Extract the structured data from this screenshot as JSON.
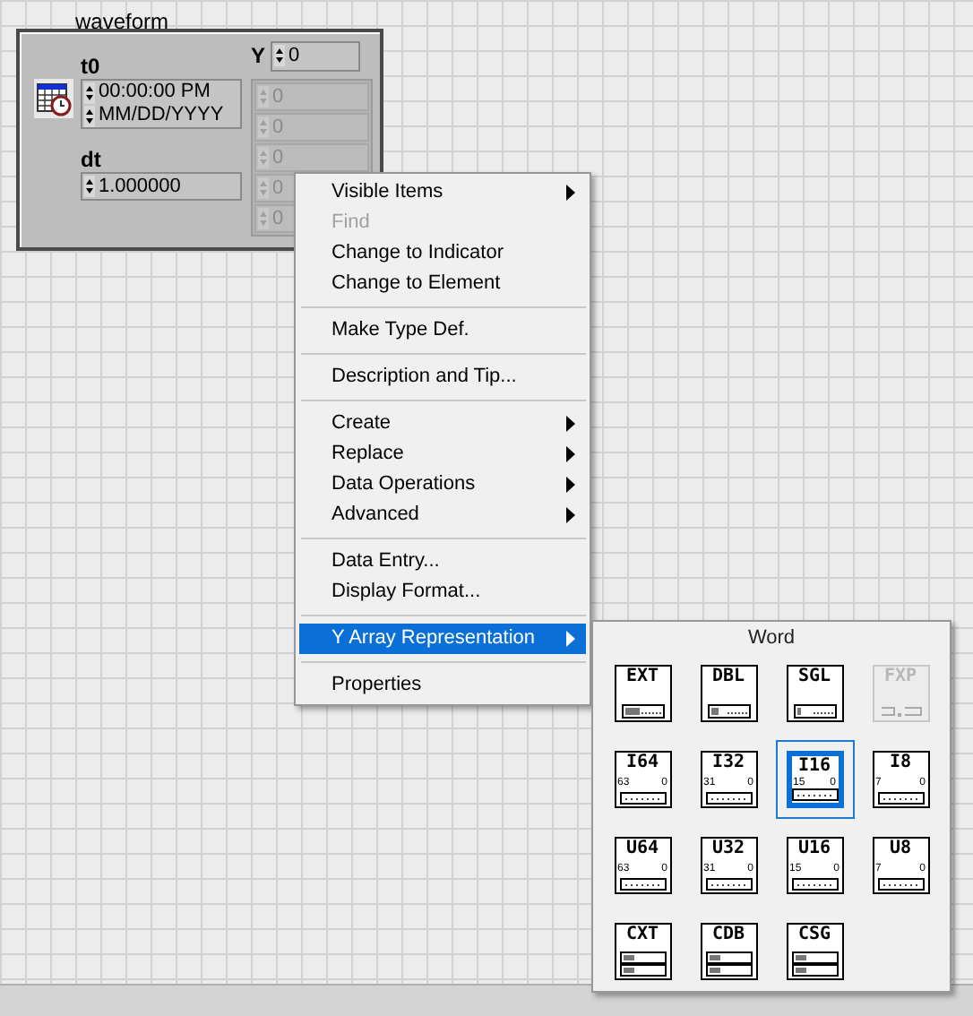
{
  "cluster": {
    "label": "waveform",
    "t0": {
      "label": "t0",
      "time": "00:00:00 PM",
      "date": "MM/DD/YYYY"
    },
    "dt": {
      "label": "dt",
      "value": "1.000000"
    },
    "y": {
      "label": "Y",
      "index": "0",
      "values": [
        {
          "value": "0",
          "disabled": true
        },
        {
          "value": "0",
          "disabled": true
        },
        {
          "value": "0",
          "disabled": true
        },
        {
          "value": "0",
          "disabled": true
        },
        {
          "value": "0",
          "disabled": true
        }
      ]
    }
  },
  "context_menu": [
    {
      "kind": "item",
      "label": "Visible Items",
      "submenu": true,
      "disabled": false,
      "selected": false
    },
    {
      "kind": "item",
      "label": "Find",
      "submenu": false,
      "disabled": true,
      "selected": false
    },
    {
      "kind": "item",
      "label": "Change to Indicator",
      "submenu": false,
      "disabled": false,
      "selected": false
    },
    {
      "kind": "item",
      "label": "Change to Element",
      "submenu": false,
      "disabled": false,
      "selected": false
    },
    {
      "kind": "separator"
    },
    {
      "kind": "item",
      "label": "Make Type Def.",
      "submenu": false,
      "disabled": false,
      "selected": false
    },
    {
      "kind": "separator"
    },
    {
      "kind": "item",
      "label": "Description and Tip...",
      "submenu": false,
      "disabled": false,
      "selected": false
    },
    {
      "kind": "separator"
    },
    {
      "kind": "item",
      "label": "Create",
      "submenu": true,
      "disabled": false,
      "selected": false
    },
    {
      "kind": "item",
      "label": "Replace",
      "submenu": true,
      "disabled": false,
      "selected": false
    },
    {
      "kind": "item",
      "label": "Data Operations",
      "submenu": true,
      "disabled": false,
      "selected": false
    },
    {
      "kind": "item",
      "label": "Advanced",
      "submenu": true,
      "disabled": false,
      "selected": false
    },
    {
      "kind": "separator"
    },
    {
      "kind": "item",
      "label": "Data Entry...",
      "submenu": false,
      "disabled": false,
      "selected": false
    },
    {
      "kind": "item",
      "label": "Display Format...",
      "submenu": false,
      "disabled": false,
      "selected": false
    },
    {
      "kind": "separator"
    },
    {
      "kind": "item",
      "label": "Y Array Representation",
      "submenu": true,
      "disabled": false,
      "selected": true
    },
    {
      "kind": "separator"
    },
    {
      "kind": "item",
      "label": "Properties",
      "submenu": false,
      "disabled": false,
      "selected": false
    }
  ],
  "representation_palette": {
    "title": "Word",
    "types": [
      {
        "label": "EXT",
        "kind": "float",
        "selected": false,
        "disabled": false
      },
      {
        "label": "DBL",
        "kind": "float",
        "selected": false,
        "disabled": false
      },
      {
        "label": "SGL",
        "kind": "float",
        "selected": false,
        "disabled": false
      },
      {
        "label": "FXP",
        "kind": "fixed",
        "selected": false,
        "disabled": true
      },
      {
        "label": "I64",
        "kind": "int",
        "bits": [
          "63",
          "0"
        ],
        "selected": false,
        "disabled": false
      },
      {
        "label": "I32",
        "kind": "int",
        "bits": [
          "31",
          "0"
        ],
        "selected": false,
        "disabled": false
      },
      {
        "label": "I16",
        "kind": "int",
        "bits": [
          "15",
          "0"
        ],
        "selected": true,
        "disabled": false
      },
      {
        "label": "I8",
        "kind": "int",
        "bits": [
          "7",
          "0"
        ],
        "selected": false,
        "disabled": false
      },
      {
        "label": "U64",
        "kind": "int",
        "bits": [
          "63",
          "0"
        ],
        "selected": false,
        "disabled": false
      },
      {
        "label": "U32",
        "kind": "int",
        "bits": [
          "31",
          "0"
        ],
        "selected": false,
        "disabled": false
      },
      {
        "label": "U16",
        "kind": "int",
        "bits": [
          "15",
          "0"
        ],
        "selected": false,
        "disabled": false
      },
      {
        "label": "U8",
        "kind": "int",
        "bits": [
          "7",
          "0"
        ],
        "selected": false,
        "disabled": false
      },
      {
        "label": "CXT",
        "kind": "complex",
        "selected": false,
        "disabled": false
      },
      {
        "label": "CDB",
        "kind": "complex",
        "selected": false,
        "disabled": false
      },
      {
        "label": "CSG",
        "kind": "complex",
        "selected": false,
        "disabled": false
      }
    ]
  }
}
